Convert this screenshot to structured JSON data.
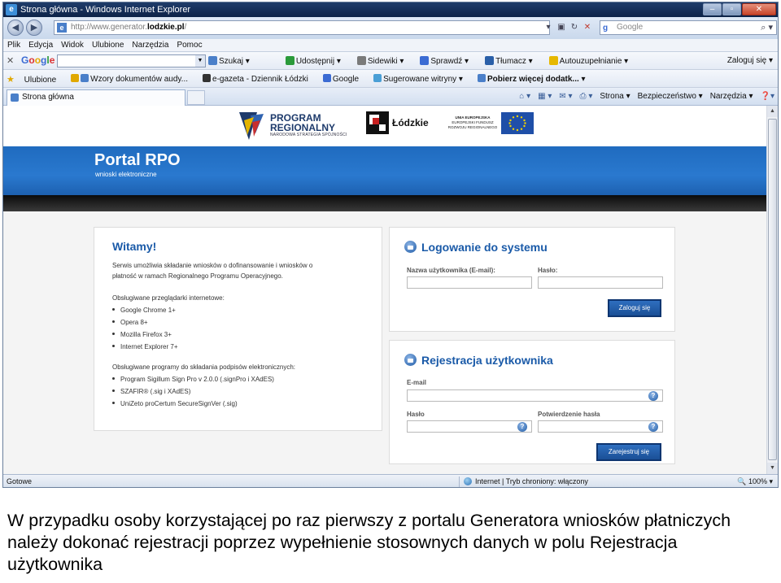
{
  "window": {
    "title": "Strona główna - Windows Internet Explorer",
    "controls": [
      "–",
      "▫",
      "✕"
    ]
  },
  "address": {
    "url_prefix": "http://www.generator.",
    "url_domain": "lodzkie.pl",
    "url_suffix": "/",
    "search_placeholder": "Google"
  },
  "menu": [
    "Plik",
    "Edycja",
    "Widok",
    "Ulubione",
    "Narzędzia",
    "Pomoc"
  ],
  "google_toolbar": {
    "logo": "Google",
    "items": [
      "Szukaj ▾",
      "Udostępnij ▾",
      "Sidewiki ▾",
      "Sprawdź ▾",
      "Tłumacz ▾",
      "Autouzupełnianie ▾"
    ],
    "signin": "Zaloguj się ▾"
  },
  "favorites": {
    "label": "Ulubione",
    "items": [
      "Wzory dokumentów audy...",
      "e-gazeta - Dziennik Łódzki",
      "Google",
      "Sugerowane witryny ▾",
      "Pobierz więcej dodatk... ▾"
    ]
  },
  "tab": {
    "label": "Strona główna"
  },
  "commandbar": [
    "Strona ▾",
    "Bezpieczeństwo ▾",
    "Narzędzia ▾"
  ],
  "logos": {
    "program_line1": "PROGRAM",
    "program_line2": "REGIONALNY",
    "program_sub": "NARODOWA STRATEGIA SPÓJNOŚCI",
    "region": "Łódzkie",
    "ue_line1": "UNIA EUROPEJSKA",
    "ue_line2": "EUROPEJSKI FUNDUSZ ROZWOJU REGIONALNEGO"
  },
  "banner": {
    "title": "Portal RPO",
    "subtitle": "wnioski elektroniczne"
  },
  "welcome": {
    "title": "Witamy!",
    "intro_line1": "Serwis umożliwia składanie wniosków o dofinansowanie i wniosków o",
    "intro_line2": "płatność w ramach Regionalnego Programu Operacyjnego.",
    "browsers_heading": "Obsługiwane przeglądarki internetowe:",
    "browsers": [
      "Google Chrome 1+",
      "Opera 8+",
      "Mozilla Firefox 3+",
      "Internet Explorer 7+"
    ],
    "signing_heading": "Obsługiwane programy do składania podpisów elektronicznych:",
    "signing": [
      "Program Sigillum Sign Pro v 2.0.0 (.signPro i XAdES)",
      "SZAFIR® (.sig i XAdES)",
      "UniZeto proCertum SecureSignVer (.sig)"
    ]
  },
  "login": {
    "title": "Logowanie do systemu",
    "username_label": "Nazwa użytkownika (E-mail):",
    "password_label": "Hasło:",
    "submit": "Zaloguj się"
  },
  "register": {
    "title": "Rejestracja użytkownika",
    "email_label": "E-mail",
    "password_label": "Hasło",
    "confirm_label": "Potwierdzenie hasła",
    "submit": "Zarejestruj się"
  },
  "status": {
    "left": "Gotowe",
    "zone": "Internet | Tryb chroniony: włączony",
    "zoom": "100%"
  },
  "caption": "W przypadku osoby korzystającej po raz pierwszy z portalu Generatora wniosków płatniczych należy dokonać rejestracji poprzez wypełnienie stosownych danych w polu Rejestracja użytkownika"
}
